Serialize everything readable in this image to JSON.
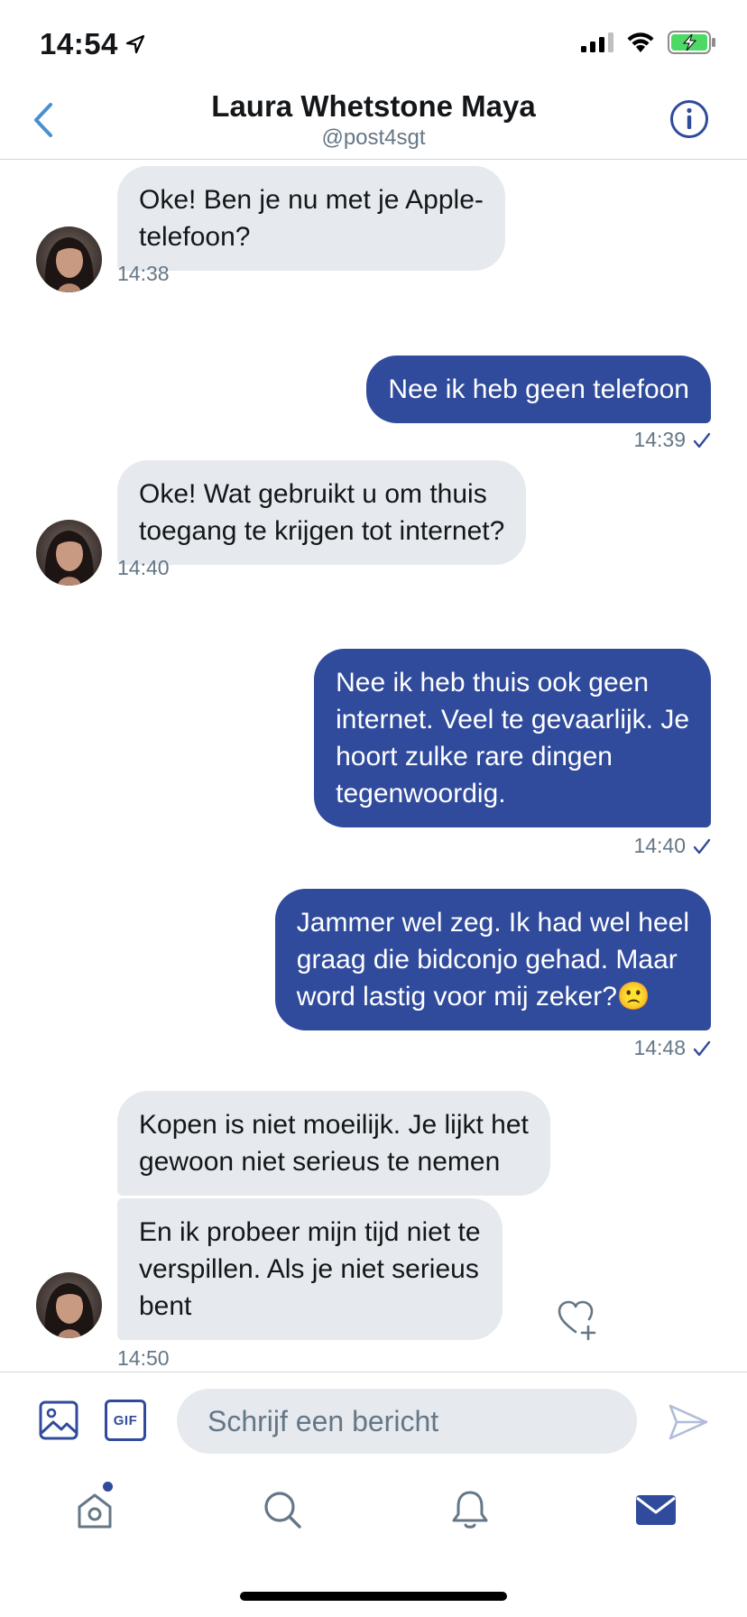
{
  "status_bar": {
    "time": "14:54"
  },
  "header": {
    "name": "Laura Whetstone Maya",
    "handle": "@post4sgt"
  },
  "messages": [
    {
      "text": "Oke! Ben je nu met je Apple-\ntelefoon?",
      "time": "14:38"
    },
    {
      "text": "Nee ik heb geen telefoon",
      "time": "14:39"
    },
    {
      "text": "Oke! Wat gebruikt u om thuis\ntoegang te krijgen tot internet?",
      "time": "14:40"
    },
    {
      "text": "Nee ik heb thuis ook geen\ninternet. Veel te gevaarlijk. Je\nhoort zulke rare dingen\ntegenwoordig.",
      "time": "14:40"
    },
    {
      "text": "Jammer wel zeg. Ik had wel heel\ngraag die bidconjo gehad. Maar\nword lastig voor mij zeker?🙁",
      "time": "14:48"
    },
    {
      "text": "Kopen is niet moeilijk. Je lijkt het\ngewoon niet serieus te nemen"
    },
    {
      "text": "En ik probeer mijn tijd niet te\nverspillen. Als je niet serieus\nbent",
      "time": "14:50"
    }
  ],
  "composer": {
    "placeholder": "Schrijf een bericht",
    "gif_label": "GIF"
  },
  "colors": {
    "accent": "#304b9c",
    "incoming_bubble": "#e6e9ee",
    "muted_text": "#657786",
    "back_arrow": "#4a8fd1",
    "battery": "#4cd964"
  },
  "icons": {
    "status": [
      "location-arrow-icon",
      "cellular-signal-icon",
      "wifi-icon",
      "battery-charging-icon"
    ],
    "header": [
      "back-chevron-icon",
      "info-icon"
    ],
    "composer": [
      "image-icon",
      "gif-icon",
      "send-icon"
    ],
    "message": [
      "heart-plus-icon",
      "read-checkmark-icon"
    ],
    "tabs": [
      "home-icon",
      "search-icon",
      "bell-icon",
      "mail-icon"
    ]
  }
}
